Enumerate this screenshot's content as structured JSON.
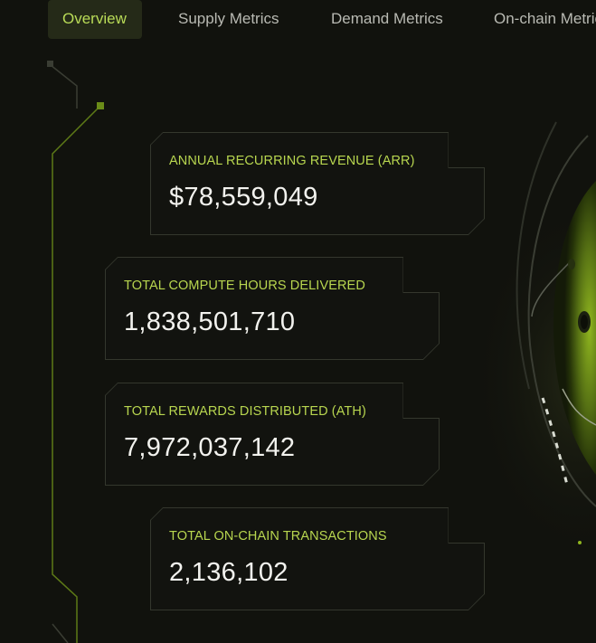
{
  "tabs": [
    {
      "label": "Overview",
      "active": true
    },
    {
      "label": "Supply Metrics",
      "active": false
    },
    {
      "label": "Demand Metrics",
      "active": false
    },
    {
      "label": "On-chain Metrics",
      "active": false
    }
  ],
  "metrics": [
    {
      "label": "ANNUAL RECURRING REVENUE (ARR)",
      "value": "$78,559,049",
      "link_icon": "arrow-up-right-icon"
    },
    {
      "label": "TOTAL COMPUTE HOURS DELIVERED",
      "value": "1,838,501,710",
      "link_icon": "arrow-up-right-icon"
    },
    {
      "label": "TOTAL REWARDS DISTRIBUTED (ATH)",
      "value": "7,972,037,142",
      "link_icon": "arrow-up-right-icon"
    },
    {
      "label": "TOTAL ON-CHAIN TRANSACTIONS",
      "value": "2,136,102",
      "link_icon": "arrow-up-right-icon"
    }
  ],
  "colors": {
    "accent": "#b9db57",
    "label": "#b8d64f",
    "value": "#f2f2ee",
    "background": "#11120d",
    "link_bg": "#4c5a1f"
  }
}
